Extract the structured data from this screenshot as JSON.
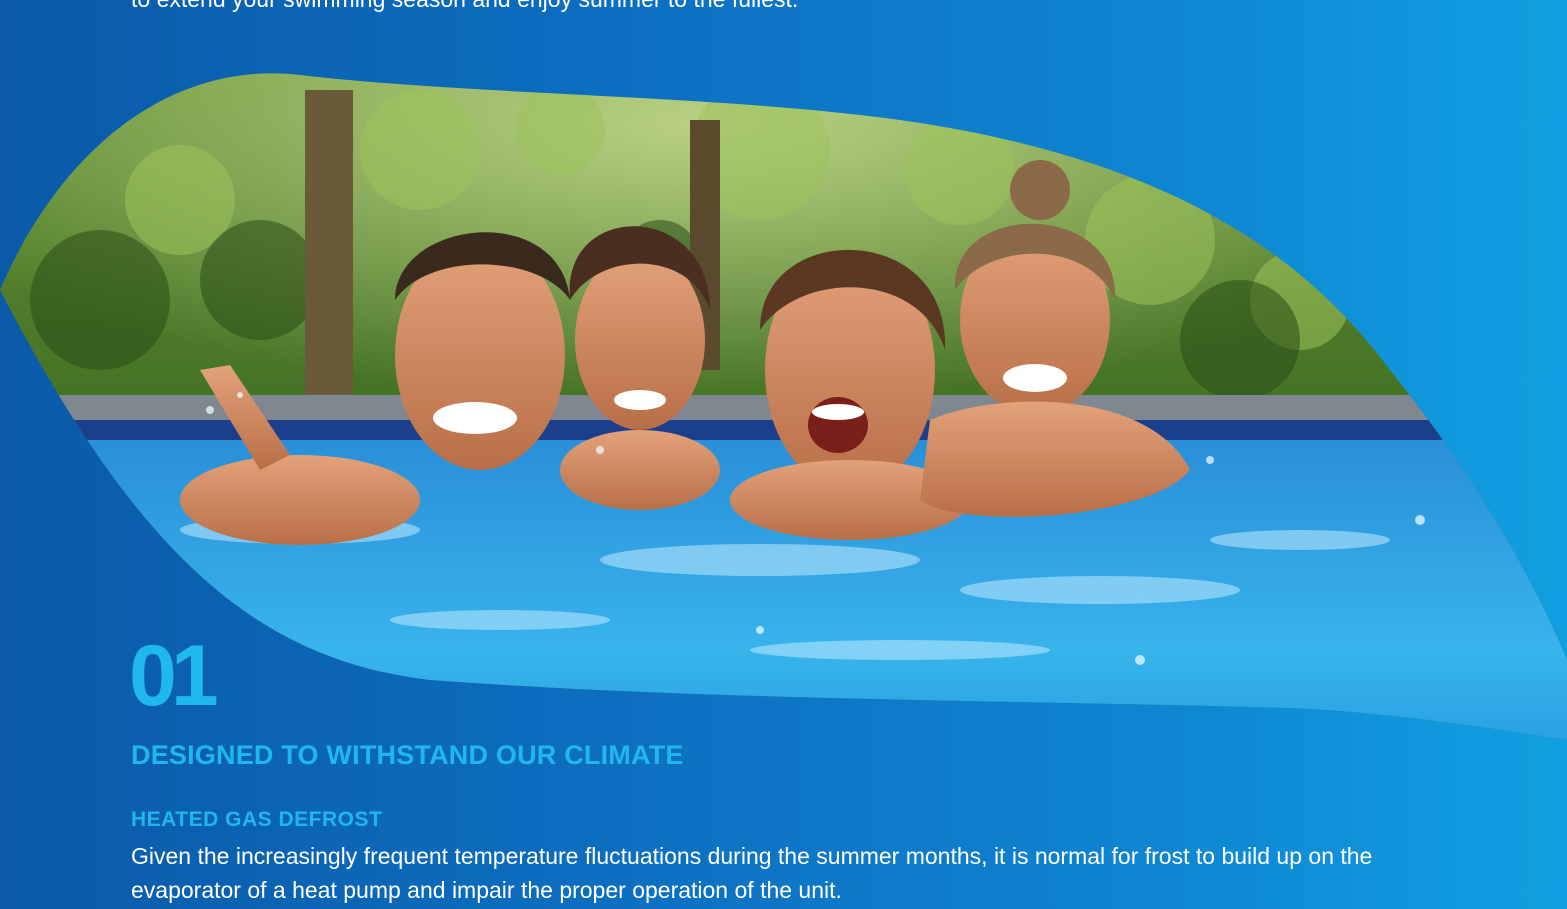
{
  "intro": {
    "text": "to extend your swimming season and enjoy summer to the fullest."
  },
  "hero_image": {
    "subject": "family of four laughing in a swimming pool"
  },
  "section": {
    "number": "01",
    "title": "DESIGNED TO WITHSTAND OUR CLIMATE",
    "subtitle": "HEATED GAS DEFROST",
    "body": "Given the increasingly frequent temperature fluctuations during the summer months, it is normal for frost to build up on the evaporator of a heat pump and impair the proper operation of the unit."
  },
  "colors": {
    "background_dark": "#0a5aa8",
    "background_light": "#10a0e0",
    "accent": "#1fb7ee",
    "text": "#ffffff"
  }
}
